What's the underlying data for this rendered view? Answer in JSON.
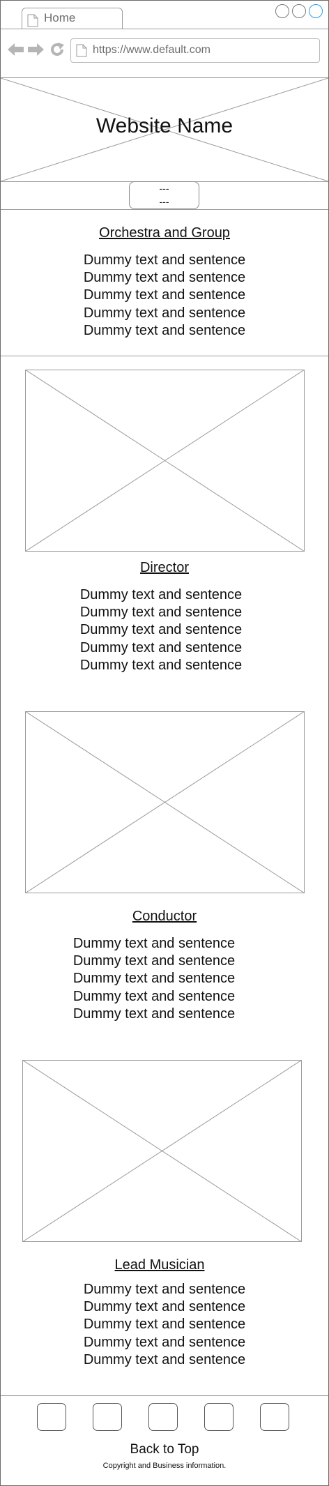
{
  "browser": {
    "tab_label": "Home",
    "url": "https://www.default.com"
  },
  "header": {
    "site_name": "Website Name",
    "menu_lines": [
      "---",
      "---"
    ]
  },
  "sections": [
    {
      "title": "Orchestra and Group",
      "lines": [
        "Dummy text and sentence",
        "Dummy text and sentence",
        "Dummy text and sentence",
        "Dummy text and sentence",
        "Dummy text and sentence"
      ]
    },
    {
      "title": "Director",
      "lines": [
        "Dummy text and sentence",
        "Dummy text and sentence",
        "Dummy text and sentence",
        "Dummy text and sentence",
        "Dummy text and sentence"
      ]
    },
    {
      "title": "Conductor",
      "lines": [
        "Dummy text and sentence",
        "Dummy text and sentence",
        "Dummy text and sentence",
        "Dummy text and sentence",
        "Dummy text and sentence"
      ]
    },
    {
      "title": "Lead Musician",
      "lines": [
        "Dummy text and sentence",
        "Dummy text and sentence",
        "Dummy text and sentence",
        "Dummy text and sentence",
        "Dummy text and sentence"
      ]
    }
  ],
  "footer": {
    "back_to_top": "Back to Top",
    "copyright": "Copyright and Business information."
  },
  "colors": {
    "window_button_active": "#2d9ee8",
    "outline": "#9a9a9a"
  },
  "icons": [
    "page-icon",
    "back-arrow-icon",
    "forward-arrow-icon",
    "reload-icon"
  ]
}
